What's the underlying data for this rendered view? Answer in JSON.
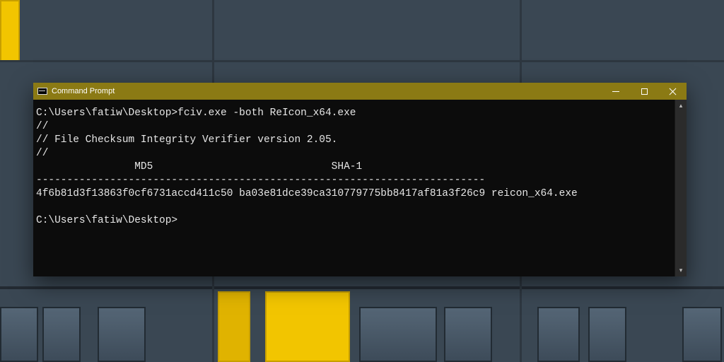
{
  "window": {
    "title": "Command Prompt"
  },
  "terminal": {
    "prompt1_path": "C:\\Users\\fatiw\\Desktop>",
    "prompt1_cmd": "fciv.exe -both ReIcon_x64.exe",
    "out_line1": "//",
    "out_line2": "// File Checksum Integrity Verifier version 2.05.",
    "out_line3": "//",
    "header_line": "                MD5                             SHA-1",
    "separator": "-------------------------------------------------------------------------",
    "hash_line": "4f6b81d3f13863f0cf6731accd411c50 ba03e81dce39ca310779775bb8417af81a3f26c9 reicon_x64.exe",
    "blank": "",
    "prompt2": "C:\\Users\\fatiw\\Desktop>"
  },
  "scrollbar": {
    "up_glyph": "▴",
    "down_glyph": "▾"
  }
}
